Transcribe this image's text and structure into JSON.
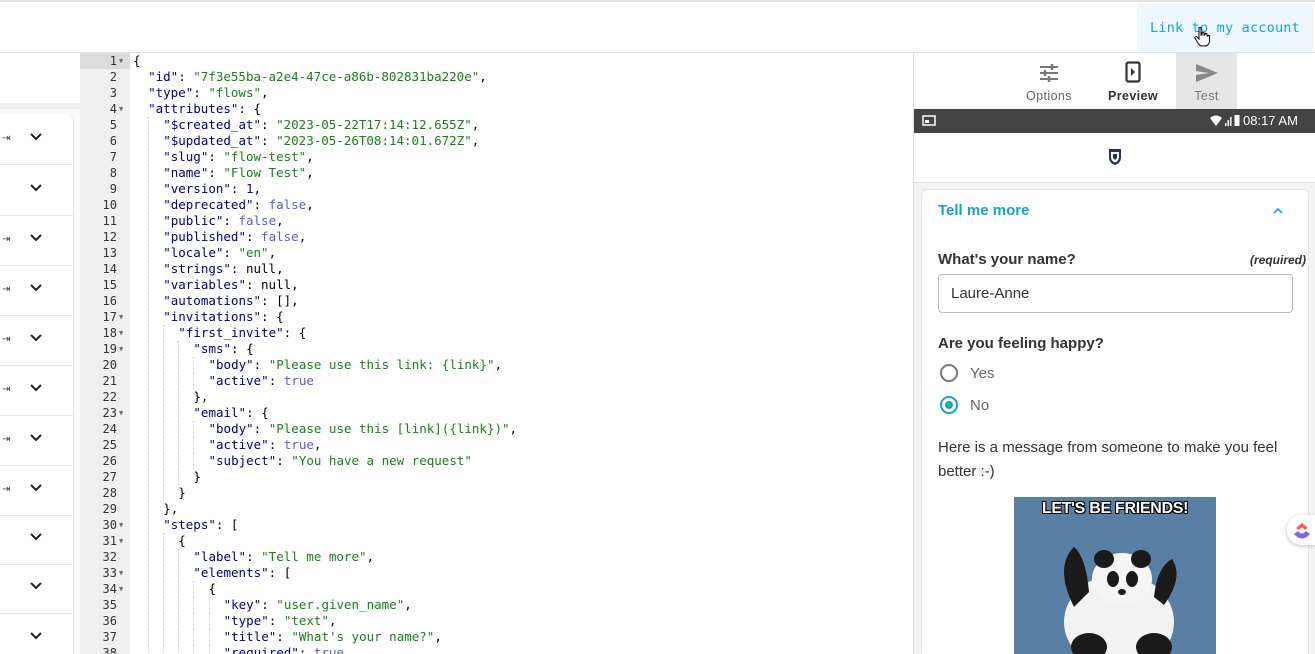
{
  "header": {
    "link_account_label": "Link to my account"
  },
  "editor": {
    "lines": [
      {
        "n": "1",
        "fold": true,
        "t": [
          [
            "p",
            "{"
          ]
        ]
      },
      {
        "n": "2",
        "t": [
          [
            "k",
            "\"id\""
          ],
          [
            "p",
            ": "
          ],
          [
            "s",
            "\"7f3e55ba-a2e4-47ce-a86b-802831ba220e\""
          ],
          [
            "p",
            ","
          ]
        ]
      },
      {
        "n": "3",
        "t": [
          [
            "k",
            "\"type\""
          ],
          [
            "p",
            ": "
          ],
          [
            "s",
            "\"flows\""
          ],
          [
            "p",
            ","
          ]
        ]
      },
      {
        "n": "4",
        "fold": true,
        "t": [
          [
            "k",
            "\"attributes\""
          ],
          [
            "p",
            ": {"
          ]
        ]
      },
      {
        "n": "5",
        "t": [
          [
            "k",
            "\"$created_at\""
          ],
          [
            "p",
            ": "
          ],
          [
            "s",
            "\"2023-05-22T17:14:12.655Z\""
          ],
          [
            "p",
            ","
          ]
        ]
      },
      {
        "n": "6",
        "t": [
          [
            "k",
            "\"$updated_at\""
          ],
          [
            "p",
            ": "
          ],
          [
            "s",
            "\"2023-05-26T08:14:01.672Z\""
          ],
          [
            "p",
            ","
          ]
        ]
      },
      {
        "n": "7",
        "t": [
          [
            "k",
            "\"slug\""
          ],
          [
            "p",
            ": "
          ],
          [
            "s",
            "\"flow-test\""
          ],
          [
            "p",
            ","
          ]
        ]
      },
      {
        "n": "8",
        "t": [
          [
            "k",
            "\"name\""
          ],
          [
            "p",
            ": "
          ],
          [
            "s",
            "\"Flow Test\""
          ],
          [
            "p",
            ","
          ]
        ]
      },
      {
        "n": "9",
        "t": [
          [
            "k",
            "\"version\""
          ],
          [
            "p",
            ": "
          ],
          [
            "n",
            "1"
          ],
          [
            "p",
            ","
          ]
        ]
      },
      {
        "n": "10",
        "t": [
          [
            "k",
            "\"deprecated\""
          ],
          [
            "p",
            ": "
          ],
          [
            "b",
            "false"
          ],
          [
            "p",
            ","
          ]
        ]
      },
      {
        "n": "11",
        "t": [
          [
            "k",
            "\"public\""
          ],
          [
            "p",
            ": "
          ],
          [
            "b",
            "false"
          ],
          [
            "p",
            ","
          ]
        ]
      },
      {
        "n": "12",
        "t": [
          [
            "k",
            "\"published\""
          ],
          [
            "p",
            ": "
          ],
          [
            "b",
            "false"
          ],
          [
            "p",
            ","
          ]
        ]
      },
      {
        "n": "13",
        "t": [
          [
            "k",
            "\"locale\""
          ],
          [
            "p",
            ": "
          ],
          [
            "s",
            "\"en\""
          ],
          [
            "p",
            ","
          ]
        ]
      },
      {
        "n": "14",
        "t": [
          [
            "k",
            "\"strings\""
          ],
          [
            "p",
            ": null,"
          ]
        ]
      },
      {
        "n": "15",
        "t": [
          [
            "k",
            "\"variables\""
          ],
          [
            "p",
            ": null,"
          ]
        ]
      },
      {
        "n": "16",
        "t": [
          [
            "k",
            "\"automations\""
          ],
          [
            "p",
            ": [],"
          ]
        ]
      },
      {
        "n": "17",
        "fold": true,
        "t": [
          [
            "k",
            "\"invitations\""
          ],
          [
            "p",
            ": {"
          ]
        ]
      },
      {
        "n": "18",
        "fold": true,
        "t": [
          [
            "k",
            "\"first_invite\""
          ],
          [
            "p",
            ": {"
          ]
        ]
      },
      {
        "n": "19",
        "fold": true,
        "t": [
          [
            "k",
            "\"sms\""
          ],
          [
            "p",
            ": {"
          ]
        ]
      },
      {
        "n": "20",
        "t": [
          [
            "k",
            "\"body\""
          ],
          [
            "p",
            ": "
          ],
          [
            "s",
            "\"Please use this link: {link}\""
          ],
          [
            "p",
            ","
          ]
        ]
      },
      {
        "n": "21",
        "t": [
          [
            "k",
            "\"active\""
          ],
          [
            "p",
            ": "
          ],
          [
            "b",
            "true"
          ]
        ]
      },
      {
        "n": "22",
        "t": [
          [
            "p",
            "},"
          ]
        ]
      },
      {
        "n": "23",
        "fold": true,
        "t": [
          [
            "k",
            "\"email\""
          ],
          [
            "p",
            ": {"
          ]
        ]
      },
      {
        "n": "24",
        "t": [
          [
            "k",
            "\"body\""
          ],
          [
            "p",
            ": "
          ],
          [
            "s",
            "\"Please use this [link]({link})\""
          ],
          [
            "p",
            ","
          ]
        ]
      },
      {
        "n": "25",
        "t": [
          [
            "k",
            "\"active\""
          ],
          [
            "p",
            ": "
          ],
          [
            "b",
            "true"
          ],
          [
            "p",
            ","
          ]
        ]
      },
      {
        "n": "26",
        "t": [
          [
            "k",
            "\"subject\""
          ],
          [
            "p",
            ": "
          ],
          [
            "s",
            "\"You have a new request\""
          ]
        ]
      },
      {
        "n": "27",
        "t": [
          [
            "p",
            "}"
          ]
        ]
      },
      {
        "n": "28",
        "t": [
          [
            "p",
            "}"
          ]
        ]
      },
      {
        "n": "29",
        "t": [
          [
            "p",
            "},"
          ]
        ]
      },
      {
        "n": "30",
        "fold": true,
        "t": [
          [
            "k",
            "\"steps\""
          ],
          [
            "p",
            ": ["
          ]
        ]
      },
      {
        "n": "31",
        "fold": true,
        "t": [
          [
            "p",
            "{"
          ]
        ]
      },
      {
        "n": "32",
        "t": [
          [
            "k",
            "\"label\""
          ],
          [
            "p",
            ": "
          ],
          [
            "s",
            "\"Tell me more\""
          ],
          [
            "p",
            ","
          ]
        ]
      },
      {
        "n": "33",
        "fold": true,
        "t": [
          [
            "k",
            "\"elements\""
          ],
          [
            "p",
            ": ["
          ]
        ]
      },
      {
        "n": "34",
        "fold": true,
        "t": [
          [
            "p",
            "{"
          ]
        ]
      },
      {
        "n": "35",
        "t": [
          [
            "k",
            "\"key\""
          ],
          [
            "p",
            ": "
          ],
          [
            "s",
            "\"user.given_name\""
          ],
          [
            "p",
            ","
          ]
        ]
      },
      {
        "n": "36",
        "t": [
          [
            "k",
            "\"type\""
          ],
          [
            "p",
            ": "
          ],
          [
            "s",
            "\"text\""
          ],
          [
            "p",
            ","
          ]
        ]
      },
      {
        "n": "37",
        "t": [
          [
            "k",
            "\"title\""
          ],
          [
            "p",
            ": "
          ],
          [
            "s",
            "\"What's your name?\""
          ],
          [
            "p",
            ","
          ]
        ]
      },
      {
        "n": "38",
        "t": [
          [
            "k",
            "\"required\""
          ],
          [
            "p",
            ": "
          ],
          [
            "b",
            "true"
          ]
        ]
      }
    ]
  },
  "preview": {
    "tabs": [
      {
        "label": "Options",
        "icon": "sliders-icon"
      },
      {
        "label": "Preview",
        "icon": "phone-icon"
      },
      {
        "label": "Test",
        "icon": "send-icon"
      }
    ],
    "status_time": "08:17 AM",
    "card_title": "Tell me more",
    "question_name": "What's your name?",
    "required_label": "(required)",
    "name_value": "Laure-Anne",
    "question_happy": "Are you feeling happy?",
    "options": [
      "Yes",
      "No"
    ],
    "selected_option": "No",
    "message": "Here is a message from someone to make you feel better :-)",
    "gif_caption": "LET'S BE FRIENDS!"
  },
  "colors": {
    "accent": "#1aa2cf",
    "status_bar": "#444444",
    "string": "#1a7f1a",
    "key": "#000080",
    "boolean": "#5b5bd6"
  }
}
